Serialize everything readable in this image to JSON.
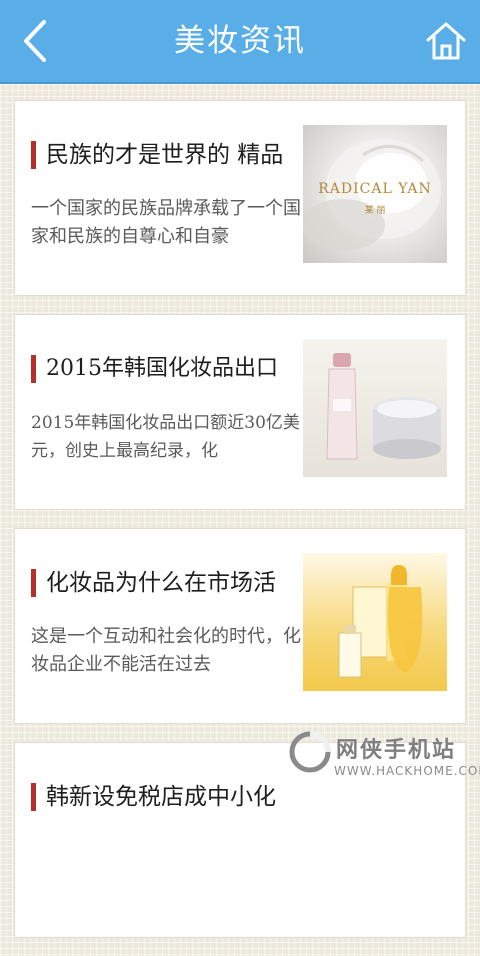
{
  "header": {
    "title": "美妆资讯",
    "back_icon": "chevron-left-icon",
    "home_icon": "home-icon",
    "bg_color": "#5aaee8"
  },
  "articles": [
    {
      "title": "民族的才是世界的 精品",
      "desc": "一个国家的民族品牌承载了一个国家和民族的自尊心和自豪",
      "thumb_brand": "RADICAL YAN",
      "thumb_sub": "某 丽"
    },
    {
      "title": "2015年韩国化妆品出口",
      "desc": "2015年韩国化妆品出口额近30亿美元，创史上最高纪录，化"
    },
    {
      "title": "化妆品为什么在市场活",
      "desc": "这是一个互动和社会化的时代，化妆品企业不能活在过去"
    },
    {
      "title": "韩新设免税店成中小化",
      "desc": ""
    }
  ],
  "watermark": {
    "text": "网侠手机站",
    "url": "WWW.HACKHOME.COM"
  },
  "accent_color": "#b23129"
}
